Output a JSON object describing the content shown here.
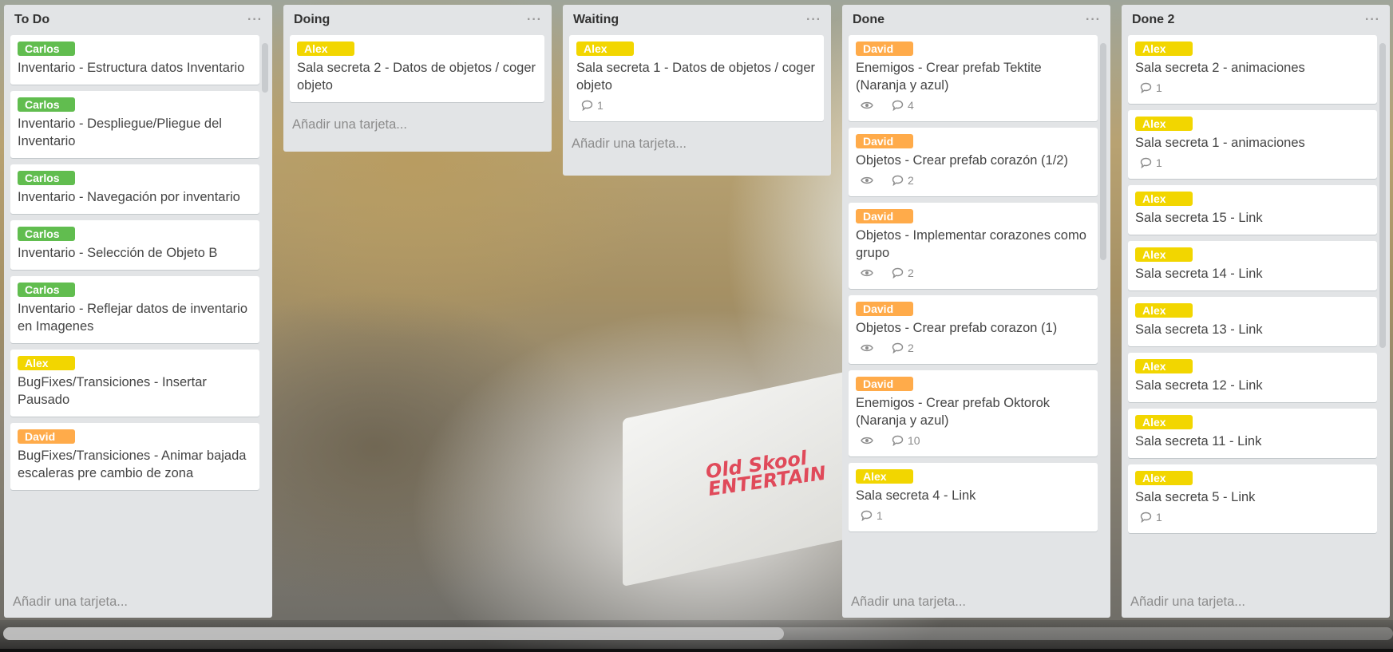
{
  "colors": {
    "green": "#61bd4f",
    "yellow": "#f2d600",
    "orange": "#ffab4a"
  },
  "background": {
    "sign_text": "Old Skool\nENTERTAIN"
  },
  "add_card_label": "Añadir una tarjeta...",
  "lists": [
    {
      "title": "To Do",
      "cards": [
        {
          "label": "Carlos",
          "color": "green",
          "title": "Inventario - Estructura datos Inventario"
        },
        {
          "label": "Carlos",
          "color": "green",
          "title": "Inventario - Despliegue/Pliegue del Inventario"
        },
        {
          "label": "Carlos",
          "color": "green",
          "title": "Inventario - Navegación por inventario"
        },
        {
          "label": "Carlos",
          "color": "green",
          "title": "Inventario - Selección de Objeto B"
        },
        {
          "label": "Carlos",
          "color": "green",
          "title": "Inventario - Reflejar datos de inventario en Imagenes"
        },
        {
          "label": "Alex",
          "color": "yellow",
          "title": "BugFixes/Transiciones - Insertar Pausado"
        },
        {
          "label": "David",
          "color": "orange",
          "title": "BugFixes/Transiciones - Animar bajada escaleras pre cambio de zona"
        }
      ]
    },
    {
      "title": "Doing",
      "cards": [
        {
          "label": "Alex",
          "color": "yellow",
          "title": "Sala secreta 2 - Datos de objetos / coger objeto"
        }
      ]
    },
    {
      "title": "Waiting",
      "cards": [
        {
          "label": "Alex",
          "color": "yellow",
          "title": "Sala secreta 1 - Datos de objetos / coger objeto",
          "comments": "1"
        }
      ]
    },
    {
      "title": "Done",
      "cards": [
        {
          "label": "David",
          "color": "orange",
          "title": "Enemigos - Crear prefab Tektite (Naranja y azul)",
          "watch": true,
          "comments": "4"
        },
        {
          "label": "David",
          "color": "orange",
          "title": "Objetos - Crear prefab corazón (1/2)",
          "watch": true,
          "comments": "2"
        },
        {
          "label": "David",
          "color": "orange",
          "title": "Objetos - Implementar corazones como grupo",
          "watch": true,
          "comments": "2"
        },
        {
          "label": "David",
          "color": "orange",
          "title": "Objetos - Crear prefab corazon (1)",
          "watch": true,
          "comments": "2"
        },
        {
          "label": "David",
          "color": "orange",
          "title": "Enemigos - Crear prefab Oktorok (Naranja y azul)",
          "watch": true,
          "comments": "10"
        },
        {
          "label": "Alex",
          "color": "yellow",
          "title": "Sala secreta 4 - Link",
          "comments": "1"
        }
      ]
    },
    {
      "title": "Done 2",
      "cards": [
        {
          "label": "Alex",
          "color": "yellow",
          "title": "Sala secreta 2 - animaciones",
          "comments": "1"
        },
        {
          "label": "Alex",
          "color": "yellow",
          "title": "Sala secreta 1 - animaciones",
          "comments": "1"
        },
        {
          "label": "Alex",
          "color": "yellow",
          "title": "Sala secreta 15 - Link"
        },
        {
          "label": "Alex",
          "color": "yellow",
          "title": "Sala secreta 14 - Link"
        },
        {
          "label": "Alex",
          "color": "yellow",
          "title": "Sala secreta 13 - Link"
        },
        {
          "label": "Alex",
          "color": "yellow",
          "title": "Sala secreta 12 - Link"
        },
        {
          "label": "Alex",
          "color": "yellow",
          "title": "Sala secreta 11 - Link"
        },
        {
          "label": "Alex",
          "color": "yellow",
          "title": "Sala secreta 5 - Link",
          "comments": "1"
        }
      ]
    }
  ]
}
